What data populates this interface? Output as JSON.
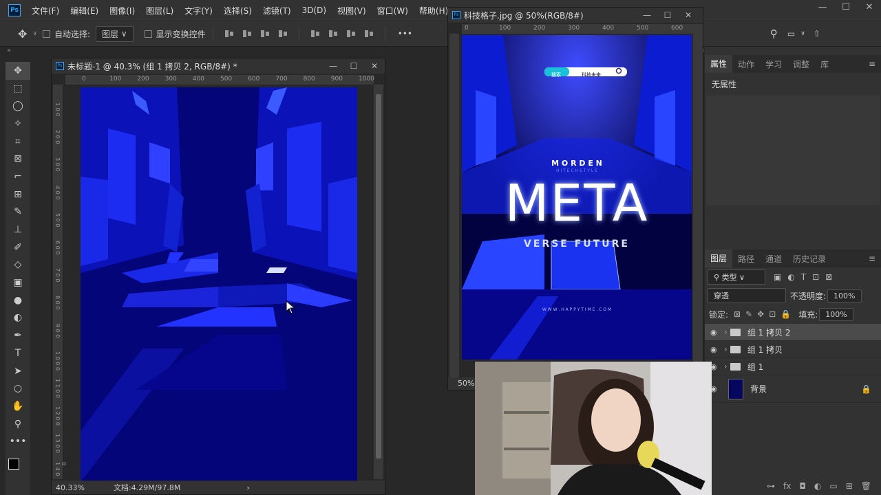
{
  "app": {
    "logo": "Ps"
  },
  "menu": [
    "文件(F)",
    "编辑(E)",
    "图像(I)",
    "图层(L)",
    "文字(Y)",
    "选择(S)",
    "滤镜(T)",
    "3D(D)",
    "视图(V)",
    "窗口(W)",
    "帮助(H)"
  ],
  "options": {
    "auto_select_label": "自动选择:",
    "auto_select_value": "图层",
    "transform_label": "显示变换控件",
    "more": "•••"
  },
  "doc1": {
    "title": "未标题-1 @ 40.3% (组 1 拷贝 2, RGB/8#) *",
    "ruler_h": [
      "0",
      "100",
      "200",
      "300",
      "400",
      "500",
      "600",
      "700",
      "800",
      "900",
      "1000"
    ],
    "ruler_v": [
      "1 0 0",
      "2 0 0",
      "3 0 0",
      "4 0 0",
      "5 0 0",
      "6 0 0",
      "7 0 0",
      "8 0 0",
      "9 0 0",
      "1 0 0 0",
      "1 1 0 0",
      "1 2 0 0",
      "1 3 0 0",
      "1 4 0 0"
    ],
    "zoom": "40.33%",
    "docinfo": "文档:4.29M/97.8M"
  },
  "doc2": {
    "title": "科技格子.jpg @ 50%(RGB/8#)",
    "ruler_h": [
      "0",
      "100",
      "200",
      "300",
      "400",
      "500",
      "600"
    ],
    "zoom": "50%",
    "poster": {
      "search_btn": "搜索",
      "search_text": "科技未来",
      "morden": "M O R D E N",
      "hitech": "H I T E C H   S T Y L E",
      "meta": "META",
      "verse": "VERSE FUTURE",
      "url": "W W W . H A P P Y T I M E . C O M"
    }
  },
  "panel_top": {
    "tabs": [
      "属性",
      "动作",
      "学习",
      "调整",
      "库"
    ],
    "active": "属性",
    "content": "无属性"
  },
  "layers_panel": {
    "tabs": [
      "图层",
      "路径",
      "通道",
      "历史记录"
    ],
    "active": "图层",
    "filter": "类型",
    "blend": "穿透",
    "opacity_label": "不透明度:",
    "opacity": "100%",
    "lock_label": "锁定:",
    "fill_label": "填充:",
    "fill": "100%",
    "layers": [
      {
        "name": "组 1 拷贝 2",
        "selected": true
      },
      {
        "name": "组 1 拷贝",
        "selected": false
      },
      {
        "name": "组 1",
        "selected": false
      },
      {
        "name": "背景",
        "selected": false
      }
    ]
  },
  "colors": {
    "bg": "#282828",
    "panel": "#323232",
    "canvas_dark": "#04046a",
    "canvas_blue": "#1a2bff"
  }
}
